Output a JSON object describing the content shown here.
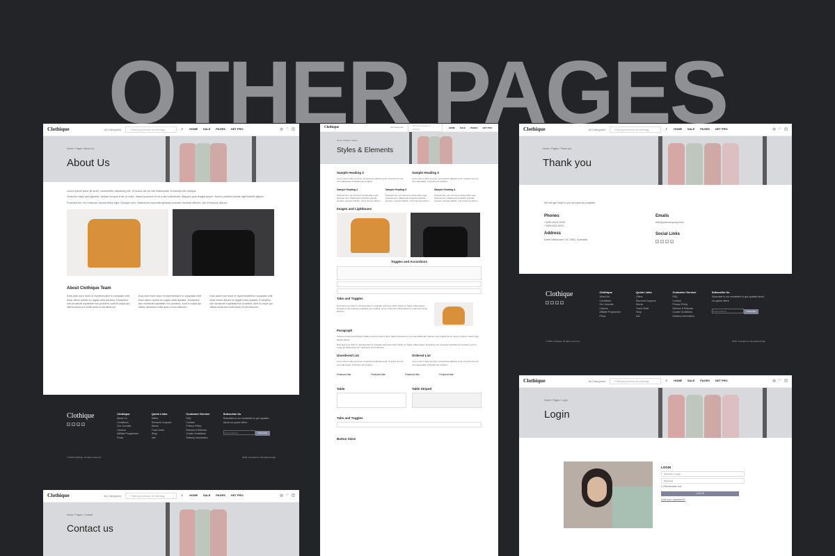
{
  "hero_title": "OTHER PAGES",
  "brand": "Clothique",
  "nav": {
    "category_label": "All Categories",
    "search_placeholder": "Find your choice of clothing",
    "links": [
      "HOME",
      "SALE",
      "PAGES",
      "GET PRO"
    ]
  },
  "about": {
    "breadcrumb": "Home / Pages / About Us",
    "title": "About Us",
    "intro": "Lorem ipsum dolor sit amet, consectetur adipiscing elit. Ut luctus dui vel nisi malesuada, id lobortis elit volutpat.",
    "para1": "Vivamus turpis quis gravida. Nullam tempus a dui ut dolor. Mauris posuere et mi a sed sollicitudin. Aliquam quis feugiat ipsum. Donec pretium mauris eget blandit aliquet.",
    "para2": "Praesent leo, est euismod, lacinia tellus eget. Quisque sem. Maecenas imperdiet gravida posuere. Aenean efficitur, nisi id tempus dictum.",
    "team_heading": "About Clothique Team",
    "team_text": "Duis aute irure dolor in reprehenderit in voluptate velit esse cillum dolore eu fugiat nulla pariatur. Excepteur sint occaecat cupidatat non proident, sunt in culpa qui officia deserunt mollit anim id est laborum."
  },
  "footer": {
    "cols": [
      {
        "title": "Clothique",
        "items": [
          "About Us",
          "Conditions",
          "Our Journals",
          "Careers",
          "Affiliate Programme",
          "Press"
        ]
      },
      {
        "title": "Quick Links",
        "items": [
          "Offers",
          "Discount Coupons",
          "Stores",
          "Track Order",
          "Shop",
          "Info"
        ]
      },
      {
        "title": "Customer Service",
        "items": [
          "FAQ",
          "Contact",
          "Privacy Policy",
          "Returns & Refunds",
          "Cookie Guidelines",
          "Delivery Information"
        ]
      }
    ],
    "subscribe_title": "Subscribe Us",
    "subscribe_text": "Subscribe to our newsletter to get updates about our grand offers.",
    "email_placeholder": "Email Address",
    "subscribe_button": "Subscribe",
    "copyright": "© 2025 Clothique. All rights reserved.",
    "credit": "HTML Template by TemplatesJungle"
  },
  "styles": {
    "breadcrumb": "Home / Pages / Styles",
    "title": "Styles & Elements",
    "headings": [
      "Sample Heading 3",
      "Sample Heading 3",
      "Sample Heading 4",
      "Sample Heading 5",
      "Sample Heading 6"
    ],
    "images_heading": "Images and Lightboxes",
    "toggles_heading": "Toggles and Accordions",
    "tabs_heading": "Tabs and Toggles",
    "paragraph_heading": "Paragraph",
    "unordered_heading": "Unordered List",
    "ordered_heading": "Ordered List",
    "featured_title": "Featured title",
    "table_heading": "Table",
    "table_striped_heading": "Table Striped",
    "tabs_toggles_heading": "Tabs and Toggles",
    "button_sizes": "Button Sizes"
  },
  "thankyou": {
    "breadcrumb": "Home / Pages / Thank you",
    "title": "Thank you",
    "message": "We will get back to you as soon as possible.",
    "phones_label": "Phones",
    "phones": [
      "+1650-6423-5033",
      "+1650-642-5023"
    ],
    "emails_label": "Emails",
    "email": "info@yourcompany.com",
    "address_label": "Address",
    "address": "North Melbourne VIC 3051, Australia",
    "social_label": "Social Links"
  },
  "login": {
    "breadcrumb": "Home / Pages / Login",
    "title": "Login",
    "form_title": "LOGIN",
    "username_placeholder": "Username / email",
    "password_placeholder": "Password",
    "remember": "Remember me",
    "button": "LOG IN",
    "lost": "Lost your password?"
  },
  "contact": {
    "breadcrumb": "Home / Pages / Contact",
    "title": "Contact us"
  },
  "colors": {
    "background": "#232427",
    "hero": "#8f9093",
    "accent": "#7f8299",
    "banner": "#d8d9dc"
  }
}
